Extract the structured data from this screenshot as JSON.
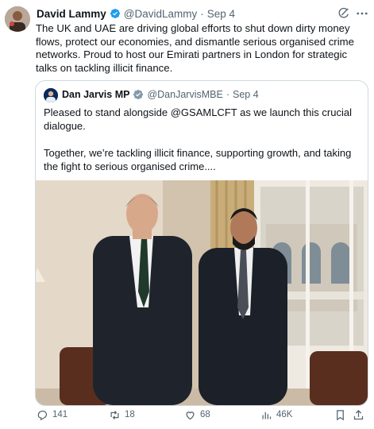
{
  "author": {
    "name": "David Lammy",
    "handle": "@DavidLammy",
    "date": "Sep 4"
  },
  "tweet_text": "The UK and UAE are driving global efforts to shut down dirty money flows, protect our economies, and dismantle serious organised crime networks. Proud to host our Emirati partners in London for strategic talks on tackling illicit finance.",
  "quoted": {
    "name": "Dan Jarvis MP",
    "handle": "@DanJarvisMBE",
    "date": "Sep 4",
    "text": "Pleased to stand alongside @GSAMLCFT as we launch this crucial dialogue.\n\nTogether, we’re tackling illicit finance, supporting growth, and taking the fight to serious organised crime...."
  },
  "actions": {
    "replies": "141",
    "reposts": "18",
    "likes": "68",
    "views": "46K"
  },
  "icons": [
    "verified-badge-icon",
    "grok-icon",
    "more-icon",
    "reply-icon",
    "repost-icon",
    "like-icon",
    "views-icon",
    "bookmark-icon",
    "share-icon"
  ],
  "colors": {
    "verified": "#1d9bf0",
    "muted": "#536471",
    "text": "#0f1419",
    "border": "#cfd9de"
  }
}
